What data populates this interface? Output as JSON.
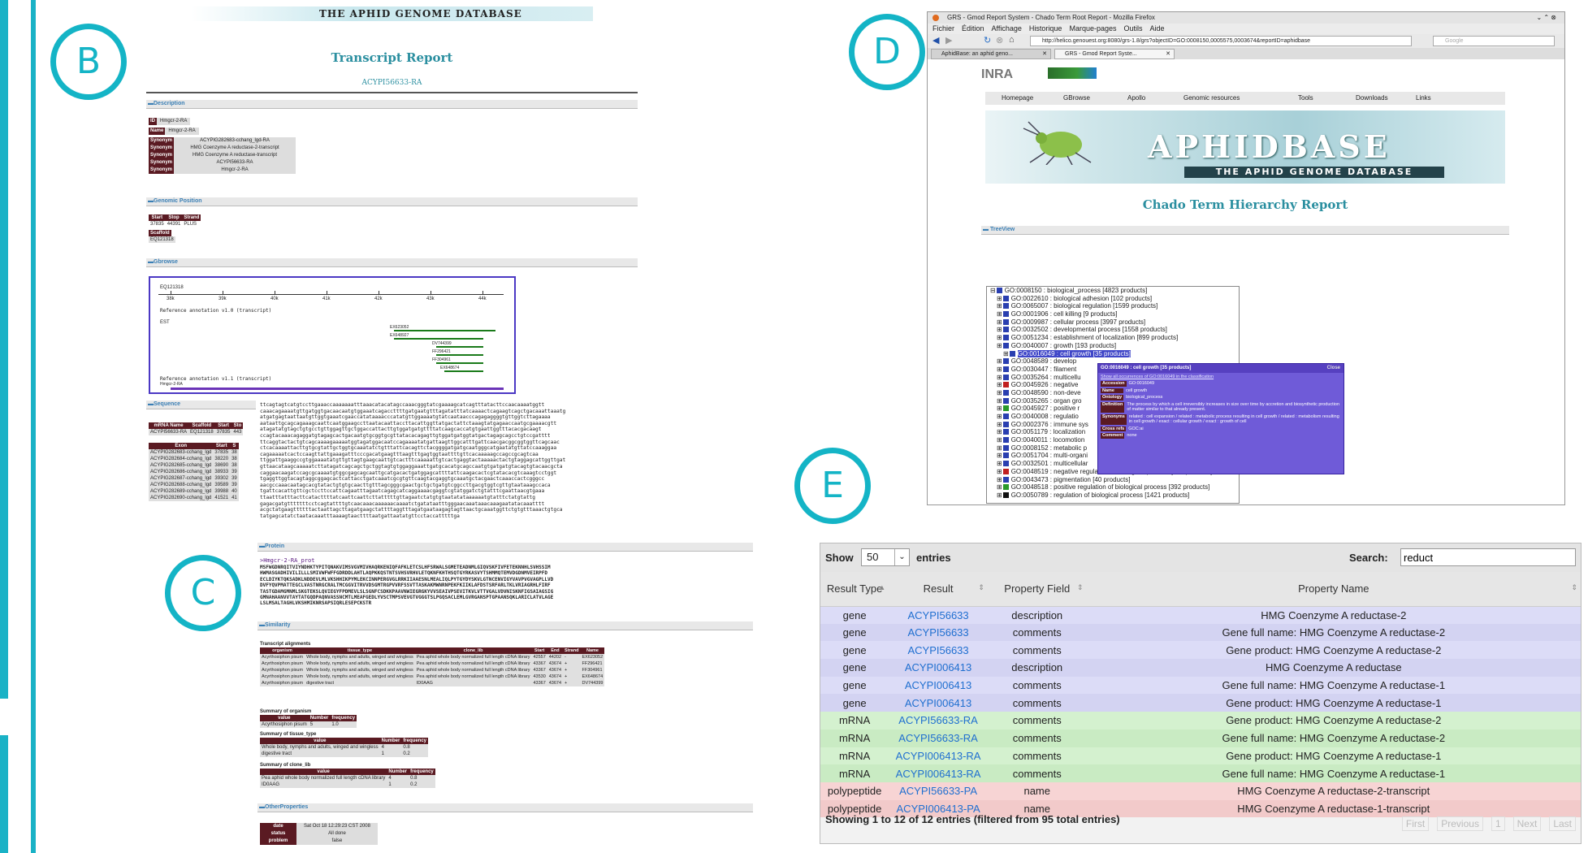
{
  "panels": {
    "b": "B",
    "c": "C",
    "d": "D",
    "e": "E"
  },
  "panel_b": {
    "banner_text": "THE APHID GENOME DATABASE",
    "title": "Transcript Report",
    "subtitle": "ACYPI56633-RA",
    "sections": {
      "description": "Description",
      "genomic_position": "Genomic Position",
      "gbrowse": "Gbrowse",
      "sequence": "Sequence",
      "protein": "Protein",
      "similarity": "Similarity",
      "other_properties": "OtherProperties"
    },
    "description": [
      {
        "tag": "ID",
        "value": "Hmgcr-2-RA"
      },
      {
        "tag": "Name",
        "value": "Hmgcr-2-RA"
      },
      {
        "tag": "Synonym",
        "value": "ACYPIG282683-cchang_lgd-RA"
      },
      {
        "tag": "Synonym",
        "value": "HMG Coenzyme A reductase-2-transcript"
      },
      {
        "tag": "Synonym",
        "value": "HMG Coenzyme A reductase-transcript"
      },
      {
        "tag": "Synonym",
        "value": "ACYPI56633-RA"
      },
      {
        "tag": "Synonym",
        "value": "Hmgcr-2-RA"
      }
    ],
    "position": {
      "headers": [
        "Start",
        "Stop",
        "Strand"
      ],
      "values": [
        "37835",
        "44391",
        "PLUS"
      ],
      "scaffold_label": "Scaffold",
      "scaffold": "EQ121318"
    },
    "gbrowse": {
      "scaffold": "EQ121318",
      "ticks": [
        "38k",
        "39k",
        "40k",
        "41k",
        "42k",
        "43k",
        "44k"
      ],
      "track1": "Reference annotation v1.0 (transcript)",
      "track_est": "EST",
      "est_labels": [
        "EX623052",
        "EX648927",
        "DV744399",
        "FF296421",
        "FF304961",
        "EX648674"
      ],
      "track2": "Reference annotation v1.1 (transcript)",
      "track2_label": "Hmgcr-2-RA"
    },
    "mrna_table": {
      "headers": [
        "mRNA Name",
        "Scaffold",
        "Start",
        "Sto"
      ],
      "row": [
        "ACYPI56633-RA",
        "EQ121318",
        "37835",
        "443"
      ]
    },
    "exons": {
      "headers": [
        "Exon",
        "Start",
        "S"
      ],
      "rows": [
        [
          "ACYPIG282683-cchang_lgd",
          "37835",
          "38"
        ],
        [
          "ACYPIG282684-cchang_lgd",
          "38220",
          "38"
        ],
        [
          "ACYPIG282685-cchang_lgd",
          "38690",
          "38"
        ],
        [
          "ACYPIG282686-cchang_lgd",
          "38933",
          "39"
        ],
        [
          "ACYPIG282687-cchang_lgd",
          "39302",
          "39"
        ],
        [
          "ACYPIG282688-cchang_lgd",
          "39589",
          "39"
        ],
        [
          "ACYPIG282689-cchang_lgd",
          "39988",
          "40"
        ],
        [
          "ACYPIG282690-cchang_lgd",
          "41521",
          "41"
        ]
      ]
    },
    "sequence_lines": [
      "ttcagtagtcatgtccttgaaaccaaaaaaatttaaacatacatagccaaacgggtatcgaaaagcatcagtttatacttccaacaaaatggtt",
      "caaacagaaaatgttgatggtgacaacaatgtggaaatcagaccttttgatgaatgtttagatatttatcaaaactcagaagtcagctgacaaattaaatg",
      "atgatgagtaattaatgttggtgaaatcgaaccatataaaacccatatgttggaaaatgtatcaataacccagagaggggtgttggtcttagaaaa",
      "aataattgcagcagaaagcaattcaatggaagccttaatacaattaccttacattggttatgactattctaaagtatgagaaccaatgcgaaaacgtt",
      "atagatatgtagctgtgcctgttggagttgctggaccattacttgtggatgatgttttatcaagcaccatgtgaattggtttacacgacaagt",
      "ccagtacaaacagaggatgtagagcactgacaatgtgcggtgcgttatacacagagttgtggatgatggtatgactagagcagcctgtccgatttt",
      "ttcaggtactactgtcagcaaaagaaaaatggtagatggacaatccagaaaatatgattaagttggcatttgattcaacgacggcggtggttcagcaac",
      "ctcacaaaattacttgtgcgtattgctggtgcaaatatctgtttattcacagttctacggggatgatgcaatgggcatgaatatgttatccaaaggaa",
      "cagaaaaatcactccaagttattgaaagatttcccgacatgaagtttaagtttgagtggtaattttgttcacaaaaagccagccgcagtcaa",
      "ttggattgaaggccgtggaaaatatgttgttagtgaagcaattgtcactttcaaaaattgtcactgaggtactaaaaactactgtaggagcattggttgat",
      "gttaacataagcaaaaatcttatagatcagcagctgctggtagtgtggaggaaattgatgcacatgcagccaatgtgatgatgtacagtgtacaacgcta",
      "caggaacaagatccagcgcaaaatgtggcgagcagcaattgcatgacactgatggagcattttattcaagacactcgtatacacgtcaaagtcctggt",
      "tgaggttggtacagtaggcggagcactcattacctgatcaaatcgcgtgttcaagtacgaggtgcaaatgctacgaactcaaaccactcgggcc",
      "aacgccaaacaatagcacgtatactgtgtgcaacttgtttagcgggcgaactgctgctgatgtcggccttgacgtggtcgttgtaataaagccaca",
      "tgattcacattgttcgctccttccattcagaatttagaatcagagcatcaggaaaacgaggtcgtatggatctgtatttcgaattaacgtgaaa",
      "ttaatttatttacttcatacttttatcaattcaattcttatttttgttagaatctatgtgtaatatataaaaaatgtatttctatgtattg",
      "gagacgatgtttttttcctcagtattttgtcaacaaacaaaaaacaaaatctgatataatttgggaacaaataaacaaagaatatacaaatttt",
      "acgctatgaagttttttactaattagcttagatgaagctattttaggtttagatgaataagagtagttaactgcaaatggttctgtgtttaaactgtgca",
      "tatgagcatatctaatacaaatttaaaagtaacttttaatgattaatatgttcctaccatttttga"
    ],
    "protein": {
      "header": ">Hmgcr-2-RA_prot",
      "lines": [
        "MSFWGDNRQITVIYNDHKTYPITQNAKVIMSVGVMIVHAQRKENIQFAFKLETCSLHFSRWALSGMETEADNMLGIQVSKFIVFETEKNNHLSVHSSIM",
        "HWMASGADHIVILILLLSMIVWFWFFGDRDDLAHTLAQPKKQSTNTSVHSVRHVLETQKNFKHTHSQTGYRKASVYTSHMMQTEMVDGDNMVEIRPFD",
        "ECLDIYKTQKSADKLNDDEVLMLVKSHHIKPYMLEKCINNPERGVGLRRKIIAAESNLMEALIQLPYTGYDYSKVLGTNCENVIGYVAVPVGVAGPLLVD",
        "DVFYQVPMATTEGCLVASTNRGCRALTMCGGVITRVVDSGMTRGPVVRFSSVTTASKAKMWNRNPEKFKIIKLAFDSTSRFARLTKLVRIAGRHLFIRF",
        "TASTGDAMGMNMLSKGTEKSLQVIEGYFPDMEVLSLSGNFCSDKKPAAVNWIEGRGKYVVSEAIVPSEVITKVLVTTVGALVDVNISKNFIGSAIAGSIG",
        "GMNAHAANVVTAYTATGQDPAQNVASSNCMTLMEAFGEDLYVSCTMPSVEVGTVGGGTSLPGQSACLEMLGVRGANSPTGPAANSQKLARICLATVLAGE",
        "LSLMSALTAGHLVKSHMIKNRSAPSIQRLESEPCKSTR"
      ]
    },
    "similarity": {
      "title": "Transcript alignments",
      "headers": [
        "organism",
        "tissue_type",
        "clone_lib",
        "Start",
        "End",
        "Strand",
        "Name"
      ],
      "rows": [
        [
          "Acyrthosiphon pisum",
          "Whole body, nymphs and adults, winged and wingless",
          "Pea aphid whole body normalized full length cDNA library",
          "42557",
          "44202",
          "-",
          "EX623052"
        ],
        [
          "Acyrthosiphon pisum",
          "Whole body, nymphs and adults, winged and wingless",
          "Pea aphid whole body normalized full length cDNA library",
          "43367",
          "43674",
          "+",
          "FF296421"
        ],
        [
          "Acyrthosiphon pisum",
          "Whole body, nymphs and adults, winged and wingless",
          "Pea aphid whole body normalized full length cDNA library",
          "43367",
          "43674",
          "+",
          "FF304961"
        ],
        [
          "Acyrthosiphon pisum",
          "Whole body, nymphs and adults, winged and wingless",
          "Pea aphid whole body normalized full length cDNA library",
          "43530",
          "43674",
          "+",
          "EX648674"
        ],
        [
          "Acyrthosiphon pisum",
          "digestive tract",
          "ID0AAG",
          "43367",
          "43674",
          "+",
          "DV744399"
        ]
      ]
    },
    "summary_org": {
      "title": "Summary of organism",
      "headers": [
        "value",
        "Number",
        "frequency"
      ],
      "rows": [
        [
          "Acyrthosiphon pisum",
          "5",
          "1.0"
        ]
      ]
    },
    "summary_tissue": {
      "title": "Summary of tissue_type",
      "headers": [
        "value",
        "Number",
        "frequency"
      ],
      "rows": [
        [
          "Whole body, nymphs and adults, winged and wingless",
          "4",
          "0.8"
        ],
        [
          "digestive tract",
          "1",
          "0.2"
        ]
      ]
    },
    "summary_clone": {
      "title": "Summary of clone_lib",
      "headers": [
        "value",
        "Number",
        "frequency"
      ],
      "rows": [
        [
          "Pea aphid whole body normalized full length cDNA library",
          "4",
          "0.8"
        ],
        [
          "ID0AAG",
          "1",
          "0.2"
        ]
      ]
    },
    "other_props": [
      {
        "tag": "date",
        "value": "Sat Oct 18 12:29:23 CST 2008"
      },
      {
        "tag": "status",
        "value": "All done"
      },
      {
        "tag": "problem",
        "value": "false"
      }
    ]
  },
  "panel_d": {
    "window_title": "GRS - Gmod Report System - Chado Term Root Report - Mozilla Firefox",
    "menu": [
      "Fichier",
      "Édition",
      "Affichage",
      "Historique",
      "Marque-pages",
      "Outils",
      "Aide"
    ],
    "url": "http://helico.genouest.org:8080/grs-1.8/grs?objectID=GO:0008150,0005575,0003674&reportID=aphidbase",
    "search_placeholder": "Google",
    "tabs": [
      "AphidBase: an aphid geno...",
      "GRS - Gmod Report Syste..."
    ],
    "inra": "INRA",
    "nav": [
      "Homepage",
      "GBrowse",
      "Apollo",
      "Genomic resources",
      "Tools",
      "Downloads",
      "Links"
    ],
    "logo_title": "APHIDBASE",
    "logo_subtitle": "THE APHID GENOME DATABASE",
    "report_title": "Chado Term Hierarchy Report",
    "treeview_label": "TreeView",
    "tree": [
      {
        "indent": 0,
        "text": "GO:0008150 : biological_process [4823 products]"
      },
      {
        "indent": 1,
        "text": "GO:0022610 : biological adhesion [102 products]"
      },
      {
        "indent": 1,
        "text": "GO:0065007 : biological regulation [1599 products]"
      },
      {
        "indent": 1,
        "text": "GO:0001906 : cell killing [9 products]"
      },
      {
        "indent": 1,
        "text": "GO:0009987 : cellular process [3997 products]"
      },
      {
        "indent": 1,
        "text": "GO:0032502 : developmental process [1558 products]"
      },
      {
        "indent": 1,
        "text": "GO:0051234 : establishment of localization [899 products]"
      },
      {
        "indent": 1,
        "text": "GO:0040007 : growth [193 products]"
      },
      {
        "indent": 2,
        "text": "GO:0016049 : cell growth [35 products]",
        "selected": true
      },
      {
        "indent": 1,
        "text": "GO:0048589 : develop"
      },
      {
        "indent": 1,
        "text": "GO:0030447 : filament"
      },
      {
        "indent": 1,
        "text": "GO:0035264 : multicellu"
      },
      {
        "indent": 1,
        "text": "GO:0045926 : negative",
        "special": "red"
      },
      {
        "indent": 1,
        "text": "GO:0048590 : non-deve"
      },
      {
        "indent": 1,
        "text": "GO:0035265 : organ gro"
      },
      {
        "indent": 1,
        "text": "GO:0045927 : positive r",
        "special": "green"
      },
      {
        "indent": 1,
        "text": "GO:0040008 : regulatio"
      },
      {
        "indent": 1,
        "text": "GO:0002376 : immune sys"
      },
      {
        "indent": 1,
        "text": "GO:0051179 : localization"
      },
      {
        "indent": 1,
        "text": "GO:0040011 : locomotion"
      },
      {
        "indent": 1,
        "text": "GO:0008152 : metabolic p"
      },
      {
        "indent": 1,
        "text": "GO:0051704 : multi-organi"
      },
      {
        "indent": 1,
        "text": "GO:0032501 : multicellular"
      },
      {
        "indent": 1,
        "text": "GO:0048519 : negative regulation of biological process [420 products]",
        "special": "red"
      },
      {
        "indent": 1,
        "text": "GO:0043473 : pigmentation [40 products]"
      },
      {
        "indent": 1,
        "text": "GO:0048518 : positive regulation of biological process [392 products]",
        "special": "green"
      },
      {
        "indent": 1,
        "text": "GO:0050789 : regulation of biological process [1421 products]",
        "special": "black"
      }
    ],
    "popup": {
      "title": "GO:0016049 : cell growth [35 products]",
      "close": "Close",
      "link": "Show all occurrences of GO:0016049 in the classification",
      "rows": [
        {
          "tag": "Accession",
          "value": "GO:0016049"
        },
        {
          "tag": "Name",
          "value": "cell growth"
        },
        {
          "tag": "Ontology",
          "value": "biological_process"
        },
        {
          "tag": "Definition",
          "value": "The process by which a cell irreversibly increases in size over time by accretion and biosynthetic production of matter similar to that already present."
        },
        {
          "tag": "Synonyms",
          "value": "related : cell expansion / related : metabolic process resulting in cell growth / related : metabolism resulting in cell growth / exact : cellular growth / exact : growth of cell"
        },
        {
          "tag": "Cross refs",
          "value": "GOC:ai"
        },
        {
          "tag": "Comment",
          "value": "none"
        }
      ]
    }
  },
  "panel_e": {
    "show_label": "Show",
    "entries_value": "50",
    "entries_label": "entries",
    "search_label": "Search:",
    "search_value": "reduct",
    "headers": [
      "Result Type",
      "Result",
      "Property Field",
      "Property Name"
    ],
    "rows": [
      {
        "type": "gene",
        "result": "ACYPI56633",
        "field": "description",
        "name": "HMG Coenzyme A reductase-2"
      },
      {
        "type": "gene",
        "result": "ACYPI56633",
        "field": "comments",
        "name": "Gene full name: HMG Coenzyme A reductase-2"
      },
      {
        "type": "gene",
        "result": "ACYPI56633",
        "field": "comments",
        "name": "Gene product: HMG Coenzyme A reductase-2"
      },
      {
        "type": "gene",
        "result": "ACYPI006413",
        "field": "description",
        "name": "HMG Coenzyme A reductase"
      },
      {
        "type": "gene",
        "result": "ACYPI006413",
        "field": "comments",
        "name": "Gene full name: HMG Coenzyme A reductase-1"
      },
      {
        "type": "gene",
        "result": "ACYPI006413",
        "field": "comments",
        "name": "Gene product: HMG Coenzyme A reductase-1"
      },
      {
        "type": "mRNA",
        "result": "ACYPI56633-RA",
        "field": "comments",
        "name": "Gene product: HMG Coenzyme A reductase-2"
      },
      {
        "type": "mRNA",
        "result": "ACYPI56633-RA",
        "field": "comments",
        "name": "Gene full name: HMG Coenzyme A reductase-2"
      },
      {
        "type": "mRNA",
        "result": "ACYPI006413-RA",
        "field": "comments",
        "name": "Gene product: HMG Coenzyme A reductase-1"
      },
      {
        "type": "mRNA",
        "result": "ACYPI006413-RA",
        "field": "comments",
        "name": "Gene full name: HMG Coenzyme A reductase-1"
      },
      {
        "type": "polypeptide",
        "result": "ACYPI56633-PA",
        "field": "name",
        "name": "HMG Coenzyme A reductase-2-transcript"
      },
      {
        "type": "polypeptide",
        "result": "ACYPI006413-PA",
        "field": "name",
        "name": "HMG Coenzyme A reductase-1-transcript"
      }
    ],
    "footer": "Showing 1 to 12 of 12 entries (filtered from 95 total entries)",
    "pager": [
      "First",
      "Previous",
      "1",
      "Next",
      "Last"
    ]
  }
}
